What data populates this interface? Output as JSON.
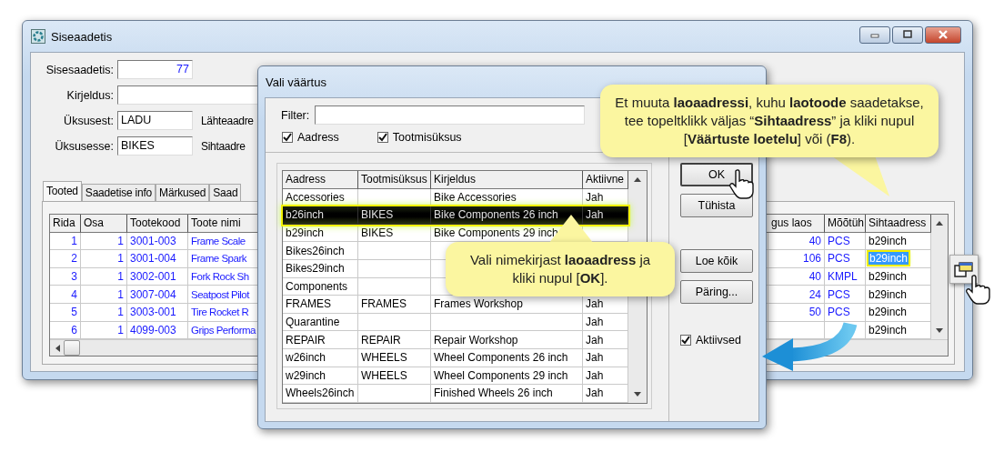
{
  "main_window": {
    "title": "Siseaadetis",
    "fields": [
      {
        "label": "Sisesaadetis:",
        "value": "77",
        "kind": "number"
      },
      {
        "label": "Kirjeldus:",
        "kind": "wide"
      },
      {
        "label": "Üksusest:",
        "value": "LADU",
        "kind": "text",
        "side_label": "Lähteaadre"
      },
      {
        "label": "Üksusesse:",
        "value": "BIKES",
        "kind": "text",
        "side_label": "Sihtaadre"
      }
    ],
    "tabs": [
      {
        "label": "Tooted",
        "selected": true
      },
      {
        "label": "Saadetise info",
        "selected": false
      },
      {
        "label": "Märkused",
        "selected": false
      },
      {
        "label": "Saad",
        "selected": false
      }
    ],
    "table": {
      "columns": [
        "Rida",
        "Osa",
        "Tootekood",
        "Toote nimi",
        "gus laos",
        "Mõõtüh",
        "Sihtaadress"
      ],
      "rows": [
        {
          "rida": "1",
          "osa": "1",
          "code": "3001-003",
          "name": "Frame Scale",
          "qty": "40",
          "unit": "PCS",
          "address": "b29inch",
          "selected": false
        },
        {
          "rida": "2",
          "osa": "1",
          "code": "3001-004",
          "name": "Frame Spark",
          "qty": "106",
          "unit": "PCS",
          "address": "b29inch",
          "selected": true
        },
        {
          "rida": "3",
          "osa": "1",
          "code": "3002-001",
          "name": "Fork Rock Sh",
          "qty": "40",
          "unit": "KMPL",
          "address": "b29inch",
          "selected": false
        },
        {
          "rida": "4",
          "osa": "1",
          "code": "3007-004",
          "name": "Seatpost Pilot",
          "qty": "24",
          "unit": "PCS",
          "address": "b29inch",
          "selected": false
        },
        {
          "rida": "5",
          "osa": "1",
          "code": "3003-001",
          "name": "Tire Rocket R",
          "qty": "50",
          "unit": "PCS",
          "address": "b29inch",
          "selected": false
        },
        {
          "rida": "6",
          "osa": "1",
          "code": "4099-003",
          "name": "Grips Performa",
          "address": "b29inch",
          "selected": false
        }
      ]
    }
  },
  "dialog": {
    "title": "Vali väärtus",
    "filter_label": "Filter:",
    "checkboxes": [
      {
        "label": "Aadress",
        "checked": true
      },
      {
        "label": "Tootmisüksus",
        "checked": true
      }
    ],
    "columns": [
      "Aadress",
      "Tootmisüksus",
      "Kirjeldus",
      "Aktiivne"
    ],
    "rows": [
      {
        "address": "Accessories",
        "unit": "",
        "desc": "Bike Accessories",
        "active": "Jah",
        "selected": false
      },
      {
        "address": "b26inch",
        "unit": "BIKES",
        "desc": "Bike Components 26 inch",
        "active": "Jah",
        "selected": true
      },
      {
        "address": "b29inch",
        "unit": "BIKES",
        "desc": "Bike Components 29 inch",
        "selected": false
      },
      {
        "address": "Bikes26inch",
        "selected": false
      },
      {
        "address": "Bikes29inch",
        "selected": false
      },
      {
        "address": "Components",
        "selected": false
      },
      {
        "address": "FRAMES",
        "unit": "FRAMES",
        "desc": "Frames Workshop",
        "active": "Jah",
        "selected": false
      },
      {
        "address": "Quarantine",
        "active": "Jah",
        "selected": false
      },
      {
        "address": "REPAIR",
        "unit": "REPAIR",
        "desc": "Repair Workshop",
        "active": "Jah",
        "selected": false
      },
      {
        "address": "w26inch",
        "unit": "WHEELS",
        "desc": "Wheel Components 26 inch",
        "active": "Jah",
        "selected": false
      },
      {
        "address": "w29inch",
        "unit": "WHEELS",
        "desc": "Wheel Components 29 inch",
        "active": "Jah",
        "selected": false
      },
      {
        "address": "Wheels26inch",
        "desc": "Finished Wheels 26 inch",
        "active": "Jah",
        "selected": false
      }
    ],
    "buttons": [
      "OK",
      "Tühista"
    ],
    "more_buttons": [
      "Loe kõik",
      "Päring..."
    ],
    "active_filter": {
      "label": "Aktiivsed",
      "checked": true
    }
  },
  "callouts": [
    {
      "text": "Et muuta **laoaadressi**, kuhu **laotoode** saadetakse, tee topeltklikk väljas “**Sihtaadress**” ja kliki nupul [**Väärtuste loetelu**] või (**F8**)."
    },
    {
      "text": "Vali nimekirjast **laoaadress** ja kliki nupul [**OK**]."
    }
  ]
}
